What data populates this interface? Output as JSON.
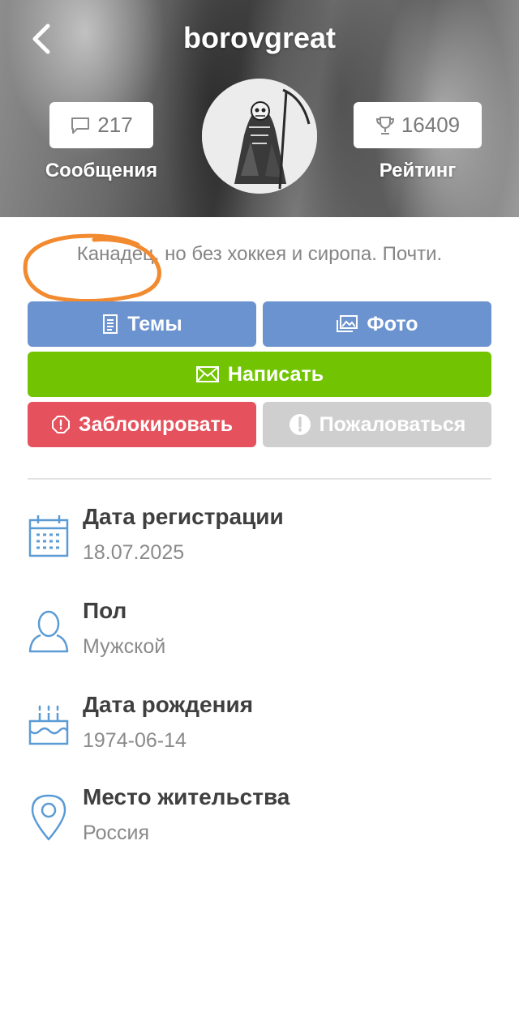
{
  "header": {
    "username": "borovgreat",
    "messages": {
      "count": "217",
      "label": "Сообщения",
      "icon": "chat-bubble-icon"
    },
    "rating": {
      "count": "16409",
      "label": "Рейтинг",
      "icon": "trophy-icon"
    }
  },
  "about": "Канадец, но без хоккея и сиропа. Почти.",
  "buttons": {
    "topics": "Темы",
    "photo": "Фото",
    "write": "Написать",
    "block": "Заблокировать",
    "report": "Пожаловаться"
  },
  "info": [
    {
      "title": "Дата регистрации",
      "value": "18.07.2025",
      "icon": "calendar-icon"
    },
    {
      "title": "Пол",
      "value": "Мужской",
      "icon": "user-icon"
    },
    {
      "title": "Дата рождения",
      "value": "1974-06-14",
      "icon": "birthday-cake-icon"
    },
    {
      "title": "Место жительства",
      "value": "Россия",
      "icon": "location-pin-icon"
    }
  ],
  "colors": {
    "blue": "#6a93cf",
    "green": "#72c403",
    "red": "#e5515c",
    "gray": "#cfcfcf",
    "icon_blue": "#5b9bd5",
    "annotation_orange": "#f28a30"
  }
}
